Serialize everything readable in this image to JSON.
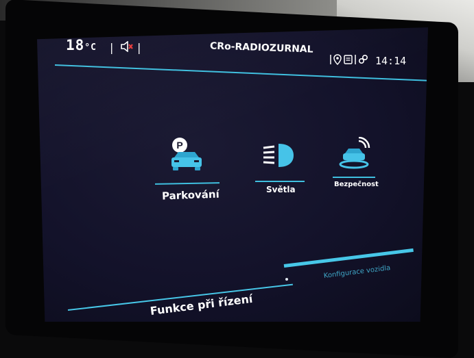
{
  "status": {
    "temperature": "18",
    "temperature_unit": "°C",
    "separator": "|",
    "station": "CRo-RADIOZURNAL",
    "clock": "14:14",
    "mute_icon": "speaker-muted-icon",
    "location_icon": "location-pin-icon",
    "messages_icon": "messages-icon",
    "link_icon": "link-icon"
  },
  "menu": {
    "tiles": [
      {
        "label": "Parkování",
        "icon": "parking-car-icon"
      },
      {
        "label": "Světla",
        "icon": "headlight-icon"
      },
      {
        "label": "Bezpečnost",
        "icon": "safety-car-icon"
      }
    ]
  },
  "tabs": {
    "left": "Funkce při řízení",
    "right": "Konfigurace vozidla"
  },
  "colors": {
    "accent": "#3fc0e0",
    "screen_bg": "#13122a",
    "text": "#ffffff"
  }
}
